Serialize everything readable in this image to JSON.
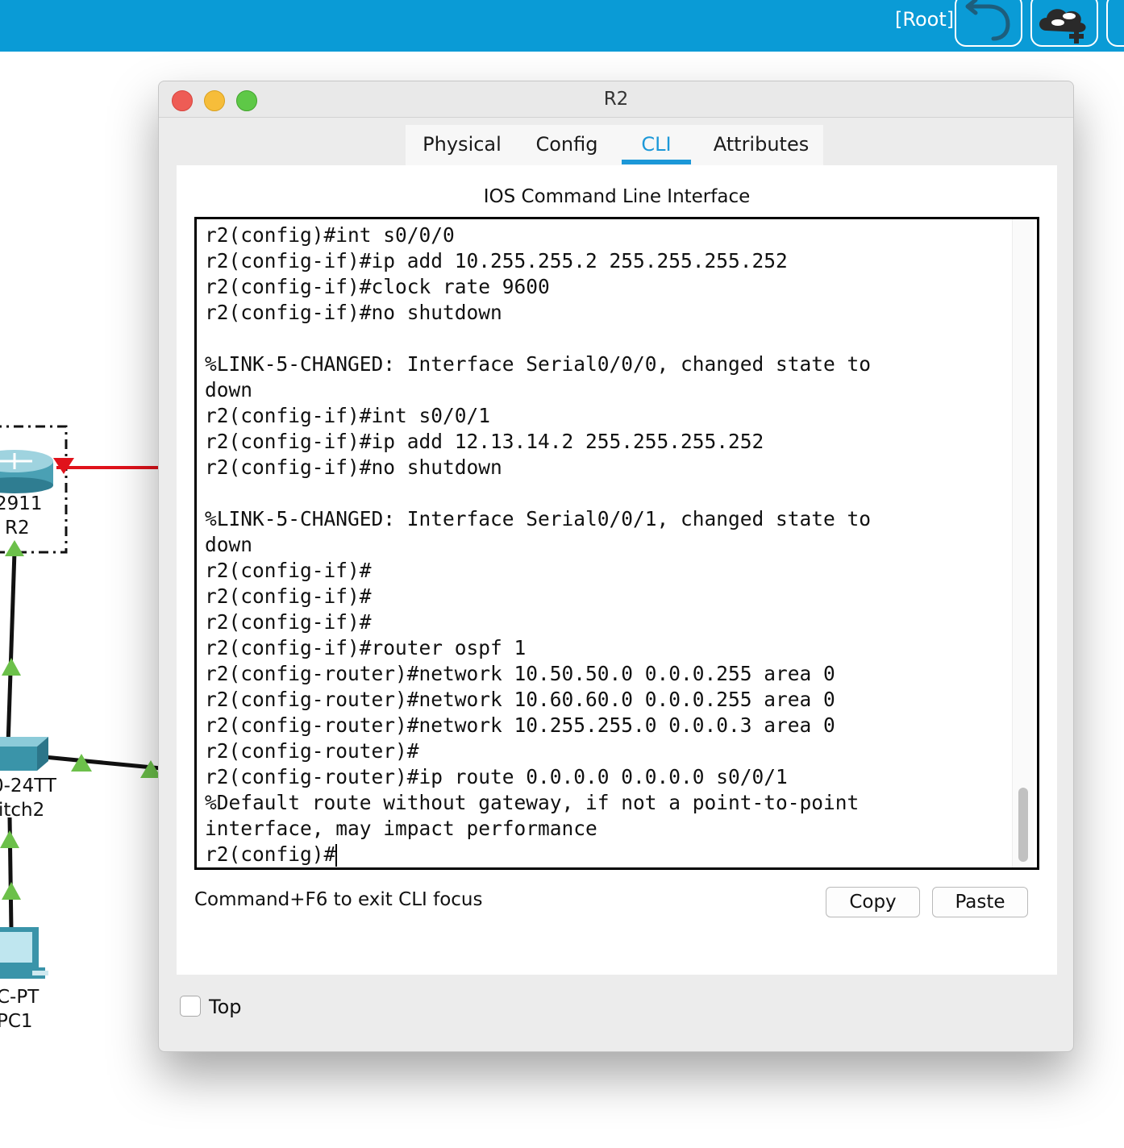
{
  "topbar": {
    "root_label": "[Root]",
    "icons": [
      "undo-icon",
      "cloud-router-add-icon"
    ]
  },
  "workspace": {
    "devices": [
      {
        "model": "2911",
        "name": "R2",
        "icon": "router-icon"
      },
      {
        "model": "0-24TT",
        "name": "itch2",
        "icon": "switch-icon"
      },
      {
        "model": "C-PT",
        "name": "PC1",
        "icon": "pc-icon"
      }
    ],
    "colors": {
      "serial_link": "#e0121b",
      "link_up": "#6cc04a"
    }
  },
  "dialog": {
    "title": "R2",
    "tabs": [
      {
        "label": "Physical",
        "active": false
      },
      {
        "label": "Config",
        "active": false
      },
      {
        "label": "CLI",
        "active": true
      },
      {
        "label": "Attributes",
        "active": false
      }
    ],
    "heading": "IOS Command Line Interface",
    "terminal_lines": [
      "r2(config)#int s0/0/0",
      "r2(config-if)#ip add 10.255.255.2 255.255.255.252",
      "r2(config-if)#clock rate 9600",
      "r2(config-if)#no shutdown",
      "",
      "%LINK-5-CHANGED: Interface Serial0/0/0, changed state to",
      "down",
      "r2(config-if)#int s0/0/1",
      "r2(config-if)#ip add 12.13.14.2 255.255.255.252",
      "r2(config-if)#no shutdown",
      "",
      "%LINK-5-CHANGED: Interface Serial0/0/1, changed state to",
      "down",
      "r2(config-if)#",
      "r2(config-if)#",
      "r2(config-if)#",
      "r2(config-if)#router ospf 1",
      "r2(config-router)#network 10.50.50.0 0.0.0.255 area 0",
      "r2(config-router)#network 10.60.60.0 0.0.0.255 area 0",
      "r2(config-router)#network 10.255.255.0 0.0.0.3 area 0",
      "r2(config-router)#",
      "r2(config-router)#ip route 0.0.0.0 0.0.0.0 s0/0/1",
      "%Default route without gateway, if not a point-to-point",
      "interface, may impact performance"
    ],
    "prompt": "r2(config)#",
    "hint": "Command+F6 to exit CLI focus",
    "copy_label": "Copy",
    "paste_label": "Paste",
    "top_label": "Top",
    "top_checked": false,
    "accent": "#1c98d8"
  }
}
